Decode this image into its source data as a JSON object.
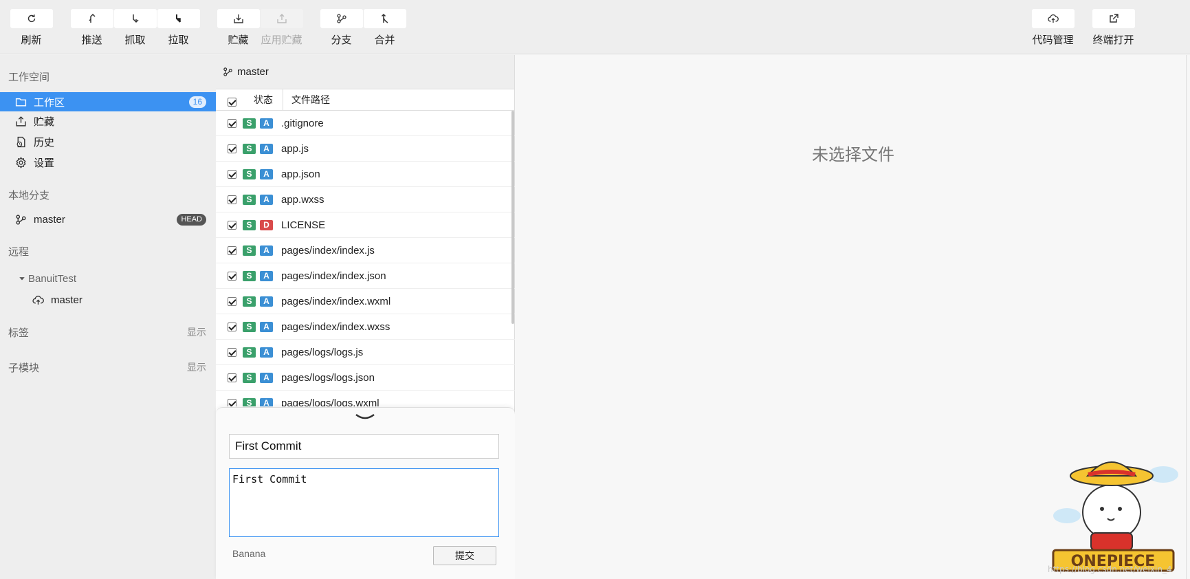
{
  "toolbar": {
    "refresh": "刷新",
    "push": "推送",
    "fetch": "抓取",
    "pull": "拉取",
    "stash": "贮藏",
    "apply_stash": "应用贮藏",
    "branch": "分支",
    "merge": "合并",
    "code_manage": "代码管理",
    "open_terminal": "终端打开"
  },
  "sidebar": {
    "workspace_title": "工作空间",
    "workspace_items": [
      {
        "label": "工作区",
        "badge": "16",
        "icon": "folder-icon",
        "active": true
      },
      {
        "label": "贮藏",
        "icon": "stash-icon"
      },
      {
        "label": "历史",
        "icon": "history-icon"
      },
      {
        "label": "设置",
        "icon": "gear-icon"
      }
    ],
    "local_branches_title": "本地分支",
    "local_branch": {
      "label": "master",
      "badge": "HEAD"
    },
    "remote_title": "远程",
    "remote_name": "BanuitTest",
    "remote_branch": "master",
    "tags_title": "标签",
    "tags_action": "显示",
    "submodules_title": "子模块",
    "submodules_action": "显示"
  },
  "filepane": {
    "current_branch": "master",
    "header_status": "状态",
    "header_path": "文件路径",
    "files": [
      {
        "status": "A",
        "path": ".gitignore"
      },
      {
        "status": "A",
        "path": "app.js"
      },
      {
        "status": "A",
        "path": "app.json"
      },
      {
        "status": "A",
        "path": "app.wxss"
      },
      {
        "status": "D",
        "path": "LICENSE"
      },
      {
        "status": "A",
        "path": "pages/index/index.js"
      },
      {
        "status": "A",
        "path": "pages/index/index.json"
      },
      {
        "status": "A",
        "path": "pages/index/index.wxml"
      },
      {
        "status": "A",
        "path": "pages/index/index.wxss"
      },
      {
        "status": "A",
        "path": "pages/logs/logs.js"
      },
      {
        "status": "A",
        "path": "pages/logs/logs.json"
      },
      {
        "status": "A",
        "path": "pages/logs/logs.wxml"
      }
    ],
    "staged_tag": "S"
  },
  "commit": {
    "summary": "First Commit",
    "description": "First Commit",
    "author": "Banana",
    "submit_label": "提交"
  },
  "rightpane": {
    "empty_text": "未选择文件",
    "watermark": "https://blog.csdn.net/weixin_4"
  },
  "colors": {
    "accent": "#3c92f2",
    "staged": "#3aa06b",
    "added": "#3b8fd4",
    "deleted": "#d94a4a"
  }
}
